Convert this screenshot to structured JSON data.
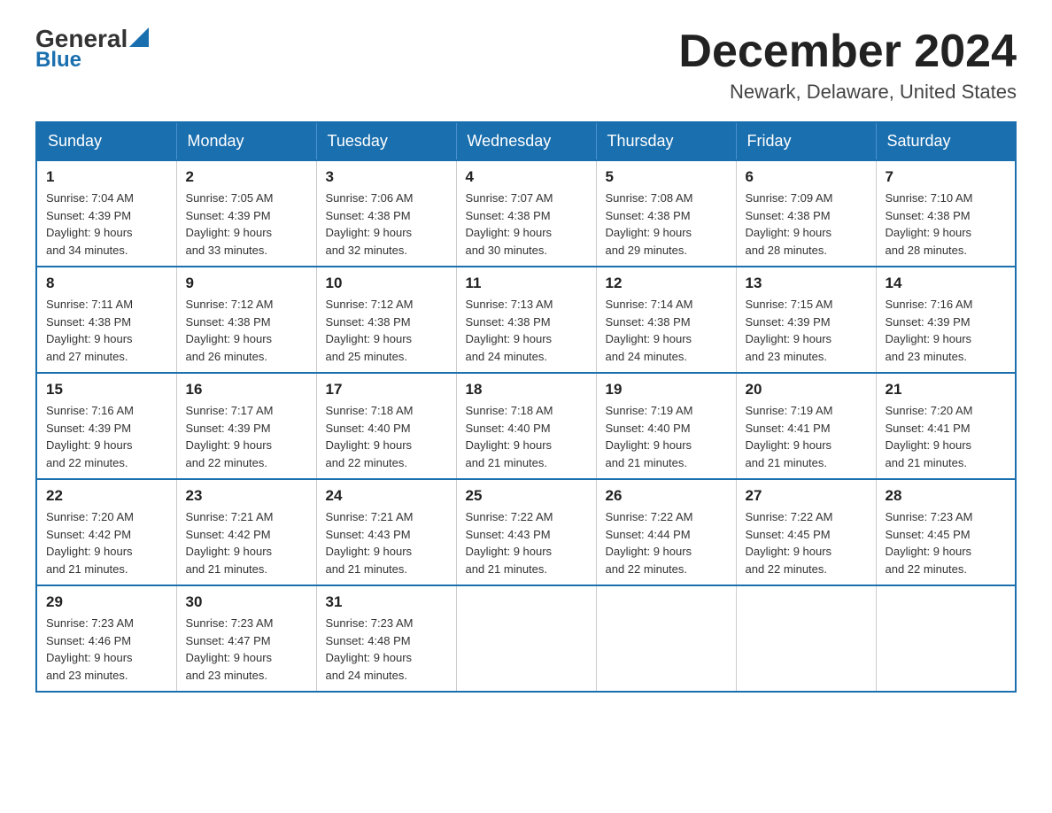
{
  "logo": {
    "general": "General",
    "blue": "Blue"
  },
  "header": {
    "month": "December 2024",
    "location": "Newark, Delaware, United States"
  },
  "weekdays": [
    "Sunday",
    "Monday",
    "Tuesday",
    "Wednesday",
    "Thursday",
    "Friday",
    "Saturday"
  ],
  "weeks": [
    [
      {
        "day": "1",
        "sunrise": "7:04 AM",
        "sunset": "4:39 PM",
        "daylight": "9 hours and 34 minutes."
      },
      {
        "day": "2",
        "sunrise": "7:05 AM",
        "sunset": "4:39 PM",
        "daylight": "9 hours and 33 minutes."
      },
      {
        "day": "3",
        "sunrise": "7:06 AM",
        "sunset": "4:38 PM",
        "daylight": "9 hours and 32 minutes."
      },
      {
        "day": "4",
        "sunrise": "7:07 AM",
        "sunset": "4:38 PM",
        "daylight": "9 hours and 30 minutes."
      },
      {
        "day": "5",
        "sunrise": "7:08 AM",
        "sunset": "4:38 PM",
        "daylight": "9 hours and 29 minutes."
      },
      {
        "day": "6",
        "sunrise": "7:09 AM",
        "sunset": "4:38 PM",
        "daylight": "9 hours and 28 minutes."
      },
      {
        "day": "7",
        "sunrise": "7:10 AM",
        "sunset": "4:38 PM",
        "daylight": "9 hours and 28 minutes."
      }
    ],
    [
      {
        "day": "8",
        "sunrise": "7:11 AM",
        "sunset": "4:38 PM",
        "daylight": "9 hours and 27 minutes."
      },
      {
        "day": "9",
        "sunrise": "7:12 AM",
        "sunset": "4:38 PM",
        "daylight": "9 hours and 26 minutes."
      },
      {
        "day": "10",
        "sunrise": "7:12 AM",
        "sunset": "4:38 PM",
        "daylight": "9 hours and 25 minutes."
      },
      {
        "day": "11",
        "sunrise": "7:13 AM",
        "sunset": "4:38 PM",
        "daylight": "9 hours and 24 minutes."
      },
      {
        "day": "12",
        "sunrise": "7:14 AM",
        "sunset": "4:38 PM",
        "daylight": "9 hours and 24 minutes."
      },
      {
        "day": "13",
        "sunrise": "7:15 AM",
        "sunset": "4:39 PM",
        "daylight": "9 hours and 23 minutes."
      },
      {
        "day": "14",
        "sunrise": "7:16 AM",
        "sunset": "4:39 PM",
        "daylight": "9 hours and 23 minutes."
      }
    ],
    [
      {
        "day": "15",
        "sunrise": "7:16 AM",
        "sunset": "4:39 PM",
        "daylight": "9 hours and 22 minutes."
      },
      {
        "day": "16",
        "sunrise": "7:17 AM",
        "sunset": "4:39 PM",
        "daylight": "9 hours and 22 minutes."
      },
      {
        "day": "17",
        "sunrise": "7:18 AM",
        "sunset": "4:40 PM",
        "daylight": "9 hours and 22 minutes."
      },
      {
        "day": "18",
        "sunrise": "7:18 AM",
        "sunset": "4:40 PM",
        "daylight": "9 hours and 21 minutes."
      },
      {
        "day": "19",
        "sunrise": "7:19 AM",
        "sunset": "4:40 PM",
        "daylight": "9 hours and 21 minutes."
      },
      {
        "day": "20",
        "sunrise": "7:19 AM",
        "sunset": "4:41 PM",
        "daylight": "9 hours and 21 minutes."
      },
      {
        "day": "21",
        "sunrise": "7:20 AM",
        "sunset": "4:41 PM",
        "daylight": "9 hours and 21 minutes."
      }
    ],
    [
      {
        "day": "22",
        "sunrise": "7:20 AM",
        "sunset": "4:42 PM",
        "daylight": "9 hours and 21 minutes."
      },
      {
        "day": "23",
        "sunrise": "7:21 AM",
        "sunset": "4:42 PM",
        "daylight": "9 hours and 21 minutes."
      },
      {
        "day": "24",
        "sunrise": "7:21 AM",
        "sunset": "4:43 PM",
        "daylight": "9 hours and 21 minutes."
      },
      {
        "day": "25",
        "sunrise": "7:22 AM",
        "sunset": "4:43 PM",
        "daylight": "9 hours and 21 minutes."
      },
      {
        "day": "26",
        "sunrise": "7:22 AM",
        "sunset": "4:44 PM",
        "daylight": "9 hours and 22 minutes."
      },
      {
        "day": "27",
        "sunrise": "7:22 AM",
        "sunset": "4:45 PM",
        "daylight": "9 hours and 22 minutes."
      },
      {
        "day": "28",
        "sunrise": "7:23 AM",
        "sunset": "4:45 PM",
        "daylight": "9 hours and 22 minutes."
      }
    ],
    [
      {
        "day": "29",
        "sunrise": "7:23 AM",
        "sunset": "4:46 PM",
        "daylight": "9 hours and 23 minutes."
      },
      {
        "day": "30",
        "sunrise": "7:23 AM",
        "sunset": "4:47 PM",
        "daylight": "9 hours and 23 minutes."
      },
      {
        "day": "31",
        "sunrise": "7:23 AM",
        "sunset": "4:48 PM",
        "daylight": "9 hours and 24 minutes."
      },
      null,
      null,
      null,
      null
    ]
  ],
  "labels": {
    "sunrise": "Sunrise:",
    "sunset": "Sunset:",
    "daylight": "Daylight:"
  }
}
